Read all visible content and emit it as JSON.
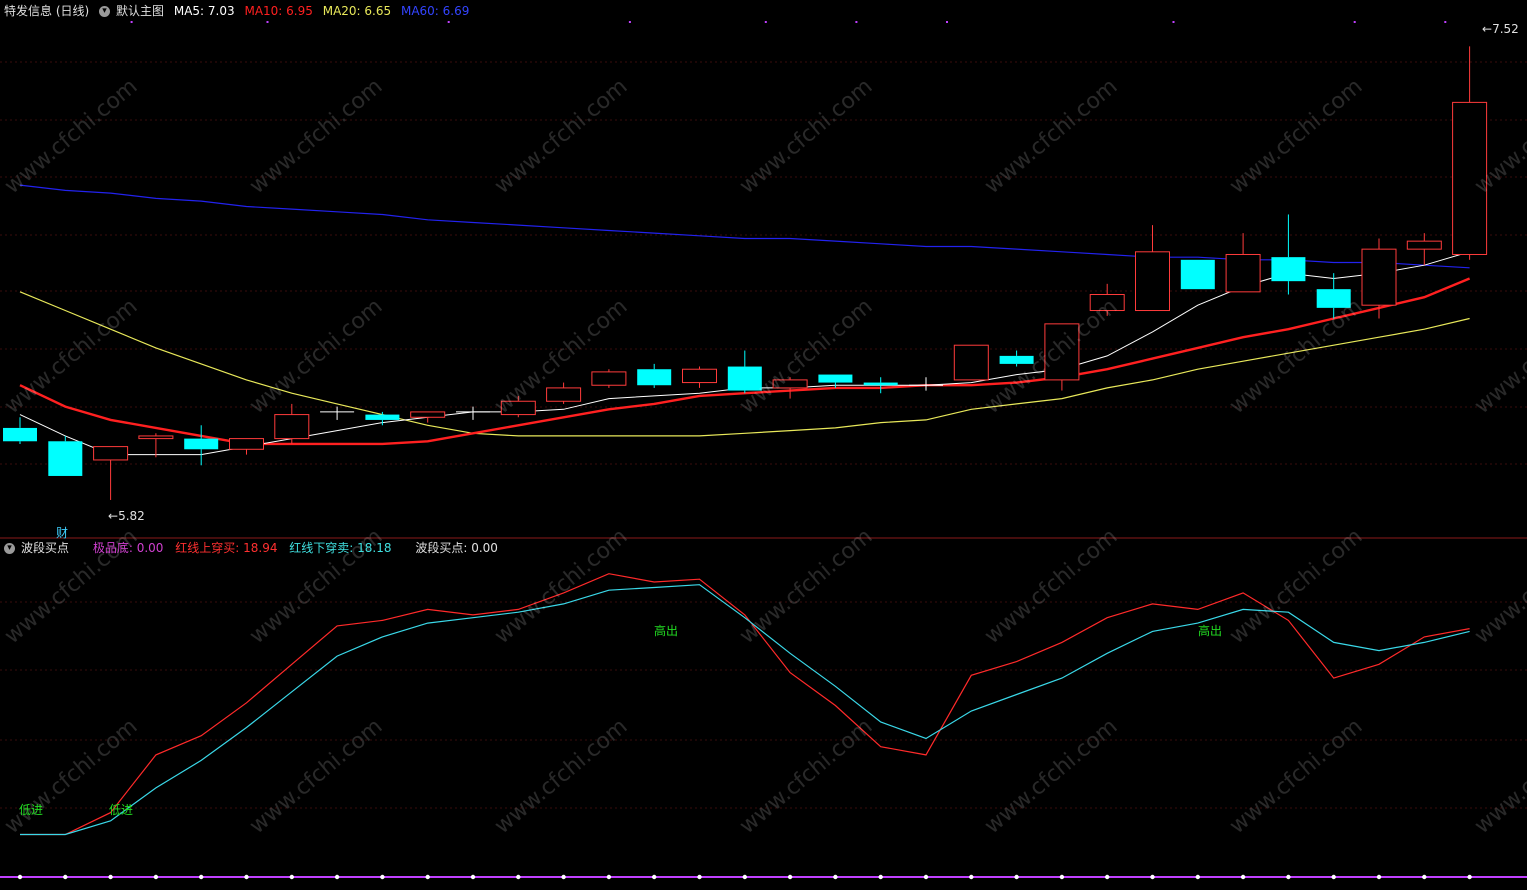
{
  "header_main": {
    "stock_title": "特发信息 (日线)",
    "menu_label": "默认主图",
    "ma5": "MA5: 7.03",
    "ma10": "MA10: 6.95",
    "ma20": "MA20: 6.65",
    "ma60": "MA60: 6.69"
  },
  "header_indicator": {
    "name": "波段买点",
    "jipindi": "极品底: 0.00",
    "hongxian_up": "红线上穿买: 18.94",
    "hongxian_down": "红线下穿卖: 18.18",
    "bodu_maidian": "波段买点: 0.00"
  },
  "annotations": {
    "high_price": "7.52",
    "low_price": "5.82",
    "cai_marker": "财",
    "signal_low_1": "低进",
    "signal_low_2": "低进",
    "signal_high_1": "高出",
    "signal_high_2": "高出"
  },
  "watermark": "www.cfchi.com",
  "colors": {
    "up": "#ff3b3b",
    "down": "#00ffff",
    "ma5": "#ffffff",
    "ma10": "#ff2020",
    "ma20": "#e8e85a",
    "ma60": "#2222ee",
    "indicator_red": "#ff2a2a",
    "indicator_cyan": "#3ad8e8",
    "signal": "#22dd22",
    "purple": "#c040ff"
  },
  "chart_data": [
    {
      "type": "candlestick",
      "title": "特发信息 (日线)",
      "ylim": [
        5.7,
        7.6
      ],
      "candles": [
        {
          "o": 6.09,
          "h": 6.13,
          "l": 6.03,
          "c": 6.04
        },
        {
          "o": 6.04,
          "h": 6.06,
          "l": 5.91,
          "c": 5.91
        },
        {
          "o": 5.97,
          "h": 6.02,
          "l": 5.82,
          "c": 6.02
        },
        {
          "o": 6.05,
          "h": 6.07,
          "l": 5.98,
          "c": 6.06
        },
        {
          "o": 6.05,
          "h": 6.1,
          "l": 5.95,
          "c": 6.01
        },
        {
          "o": 6.01,
          "h": 6.05,
          "l": 5.99,
          "c": 6.05
        },
        {
          "o": 6.05,
          "h": 6.18,
          "l": 6.03,
          "c": 6.14
        },
        {
          "o": 6.15,
          "h": 6.17,
          "l": 6.12,
          "c": 6.15
        },
        {
          "o": 6.14,
          "h": 6.15,
          "l": 6.1,
          "c": 6.12
        },
        {
          "o": 6.13,
          "h": 6.15,
          "l": 6.11,
          "c": 6.15
        },
        {
          "o": 6.15,
          "h": 6.17,
          "l": 6.12,
          "c": 6.15
        },
        {
          "o": 6.14,
          "h": 6.21,
          "l": 6.13,
          "c": 6.19
        },
        {
          "o": 6.19,
          "h": 6.26,
          "l": 6.18,
          "c": 6.24
        },
        {
          "o": 6.25,
          "h": 6.31,
          "l": 6.24,
          "c": 6.3
        },
        {
          "o": 6.31,
          "h": 6.33,
          "l": 6.24,
          "c": 6.25
        },
        {
          "o": 6.26,
          "h": 6.32,
          "l": 6.24,
          "c": 6.31
        },
        {
          "o": 6.32,
          "h": 6.38,
          "l": 6.22,
          "c": 6.23
        },
        {
          "o": 6.24,
          "h": 6.28,
          "l": 6.2,
          "c": 6.27
        },
        {
          "o": 6.29,
          "h": 6.29,
          "l": 6.24,
          "c": 6.26
        },
        {
          "o": 6.26,
          "h": 6.28,
          "l": 6.22,
          "c": 6.25
        },
        {
          "o": 6.25,
          "h": 6.28,
          "l": 6.23,
          "c": 6.25
        },
        {
          "o": 6.27,
          "h": 6.4,
          "l": 6.27,
          "c": 6.4
        },
        {
          "o": 6.36,
          "h": 6.38,
          "l": 6.32,
          "c": 6.33
        },
        {
          "o": 6.27,
          "h": 6.48,
          "l": 6.23,
          "c": 6.48
        },
        {
          "o": 6.53,
          "h": 6.63,
          "l": 6.51,
          "c": 6.59
        },
        {
          "o": 6.53,
          "h": 6.85,
          "l": 6.53,
          "c": 6.75
        },
        {
          "o": 6.72,
          "h": 6.72,
          "l": 6.61,
          "c": 6.61
        },
        {
          "o": 6.6,
          "h": 6.82,
          "l": 6.6,
          "c": 6.74
        },
        {
          "o": 6.73,
          "h": 6.89,
          "l": 6.59,
          "c": 6.64
        },
        {
          "o": 6.61,
          "h": 6.67,
          "l": 6.5,
          "c": 6.54
        },
        {
          "o": 6.55,
          "h": 6.8,
          "l": 6.5,
          "c": 6.76
        },
        {
          "o": 6.76,
          "h": 6.82,
          "l": 6.7,
          "c": 6.79
        },
        {
          "o": 6.74,
          "h": 7.52,
          "l": 6.72,
          "c": 7.31
        }
      ],
      "ma5": [
        6.14,
        6.06,
        5.99,
        5.99,
        5.99,
        6.02,
        6.05,
        6.08,
        6.11,
        6.13,
        6.15,
        6.15,
        6.16,
        6.2,
        6.21,
        6.22,
        6.24,
        6.24,
        6.25,
        6.25,
        6.25,
        6.26,
        6.29,
        6.31,
        6.36,
        6.45,
        6.55,
        6.62,
        6.67,
        6.65,
        6.67,
        6.7,
        6.75
      ],
      "ma10": [
        6.25,
        6.17,
        6.12,
        6.09,
        6.06,
        6.03,
        6.03,
        6.03,
        6.03,
        6.04,
        6.07,
        6.1,
        6.13,
        6.16,
        6.18,
        6.21,
        6.22,
        6.23,
        6.24,
        6.24,
        6.25,
        6.25,
        6.26,
        6.28,
        6.31,
        6.35,
        6.39,
        6.43,
        6.46,
        6.5,
        6.54,
        6.58,
        6.65
      ],
      "ma20": [
        6.6,
        6.53,
        6.46,
        6.39,
        6.33,
        6.27,
        6.22,
        6.18,
        6.14,
        6.1,
        6.07,
        6.06,
        6.06,
        6.06,
        6.06,
        6.06,
        6.07,
        6.08,
        6.09,
        6.11,
        6.12,
        6.16,
        6.18,
        6.2,
        6.24,
        6.27,
        6.31,
        6.34,
        6.37,
        6.4,
        6.43,
        6.46,
        6.5
      ],
      "ma60": [
        7.0,
        6.98,
        6.97,
        6.95,
        6.94,
        6.92,
        6.91,
        6.9,
        6.89,
        6.87,
        6.86,
        6.85,
        6.84,
        6.83,
        6.82,
        6.81,
        6.8,
        6.8,
        6.79,
        6.78,
        6.77,
        6.77,
        6.76,
        6.75,
        6.74,
        6.73,
        6.73,
        6.72,
        6.72,
        6.71,
        6.71,
        6.7,
        6.69
      ]
    },
    {
      "type": "line",
      "title": "波段买点",
      "ylim": [
        -5,
        105
      ],
      "series": [
        {
          "name": "红线",
          "values": [
            5,
            5,
            13,
            34,
            41,
            53,
            67,
            81,
            83,
            87,
            85,
            87,
            93,
            100,
            97,
            98,
            85,
            64,
            52,
            37,
            34,
            63,
            68,
            75,
            84,
            89,
            87,
            93,
            83,
            62,
            67,
            77,
            80
          ]
        },
        {
          "name": "青线",
          "values": [
            5,
            5,
            10,
            22,
            32,
            44,
            57,
            70,
            77,
            82,
            84,
            86,
            89,
            94,
            95,
            96,
            84,
            71,
            59,
            46,
            40,
            50,
            56,
            62,
            71,
            79,
            82,
            87,
            86,
            75,
            72,
            75,
            79
          ]
        }
      ]
    }
  ]
}
